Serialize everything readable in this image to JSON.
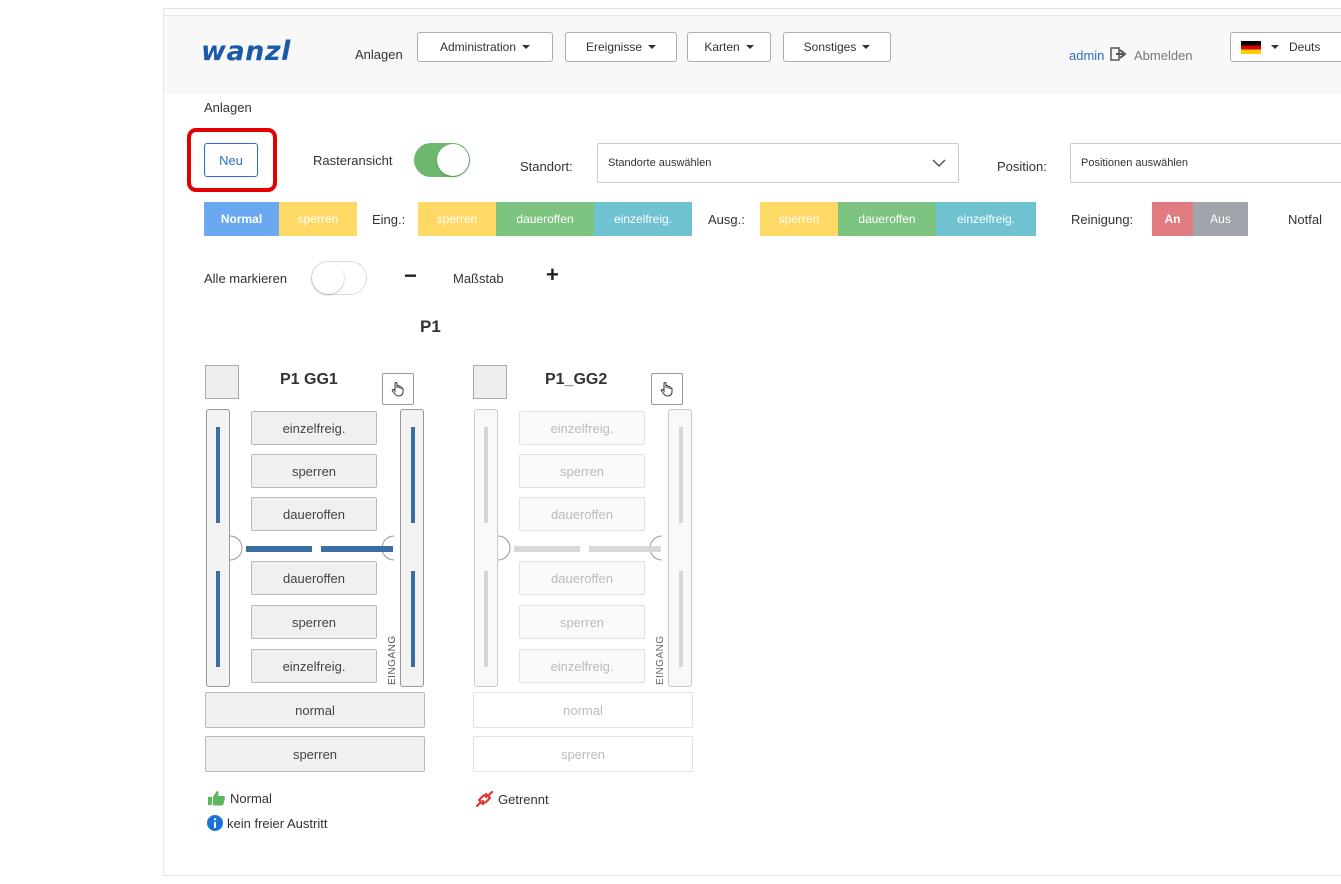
{
  "navbar": {
    "logo": "wanzl",
    "anlagen": "Anlagen",
    "menus": [
      "Administration",
      "Ereignisse",
      "Karten",
      "Sonstiges"
    ],
    "user": "admin",
    "logout": "Abmelden",
    "language": "Deuts"
  },
  "page": {
    "breadcrumb": "Anlagen",
    "new_button": "Neu",
    "grid_view_label": "Rasteransicht",
    "standort_label": "Standort:",
    "standort_placeholder": "Standorte auswählen",
    "position_label": "Position:",
    "position_placeholder": "Positionen auswählen"
  },
  "modes": {
    "normal": "Normal",
    "sperren": "sperren",
    "eing_label": "Eing.:",
    "eing": [
      "sperren",
      "daueroffen",
      "einzelfreig."
    ],
    "ausg_label": "Ausg.:",
    "ausg": [
      "sperren",
      "daueroffen",
      "einzelfreig."
    ],
    "reinigung_label": "Reinigung:",
    "reinigung_an": "An",
    "reinigung_aus": "Aus",
    "notfall_label": "Notfal"
  },
  "controls": {
    "mark_all": "Alle markieren",
    "minus": "−",
    "scale": "Maßstab",
    "plus": "+"
  },
  "group": {
    "title": "P1",
    "gates": [
      {
        "name": "P1 GG1",
        "top_buttons": [
          "einzelfreig.",
          "sperren",
          "daueroffen"
        ],
        "bottom_buttons": [
          "daueroffen",
          "sperren",
          "einzelfreig."
        ],
        "eingang": "EINGANG",
        "normal": "normal",
        "sperren": "sperren",
        "status": [
          "Normal",
          "kein freier Austritt"
        ]
      },
      {
        "name": "P1_GG2",
        "top_buttons": [
          "einzelfreig.",
          "sperren",
          "daueroffen"
        ],
        "bottom_buttons": [
          "daueroffen",
          "sperren",
          "einzelfreig."
        ],
        "eingang": "EINGANG",
        "normal": "normal",
        "sperren": "sperren",
        "status": [
          "Getrennt"
        ]
      }
    ]
  },
  "colors": {
    "normal": "#6aa9f2",
    "sperren": "#ffd966",
    "daueroffen": "#7cc47f",
    "einzelfreig": "#6fc3d0",
    "an": "#e07b82",
    "aus": "#a1a5ab",
    "toggle_on": "#6cb86c",
    "highlight": "#e40000"
  }
}
